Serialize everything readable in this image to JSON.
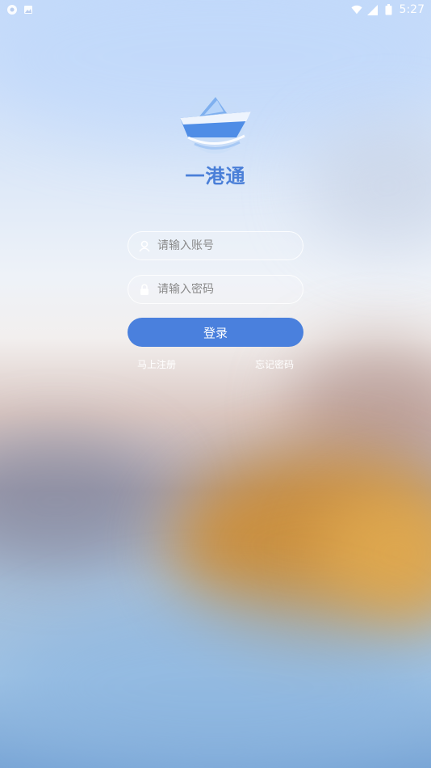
{
  "status_bar": {
    "time": "5:27",
    "icons": [
      "chrome-icon",
      "image-notification-icon",
      "wifi-icon",
      "signal-icon",
      "battery-icon"
    ]
  },
  "app": {
    "title": "一港通",
    "logo_icon": "ship-logo-icon"
  },
  "form": {
    "account_placeholder": "请输入账号",
    "password_placeholder": "请输入密码",
    "login_label": "登录",
    "register_label": "马上注册",
    "forgot_label": "忘记密码"
  },
  "colors": {
    "brand": "#4a80dd",
    "title": "#4a7fd8"
  }
}
